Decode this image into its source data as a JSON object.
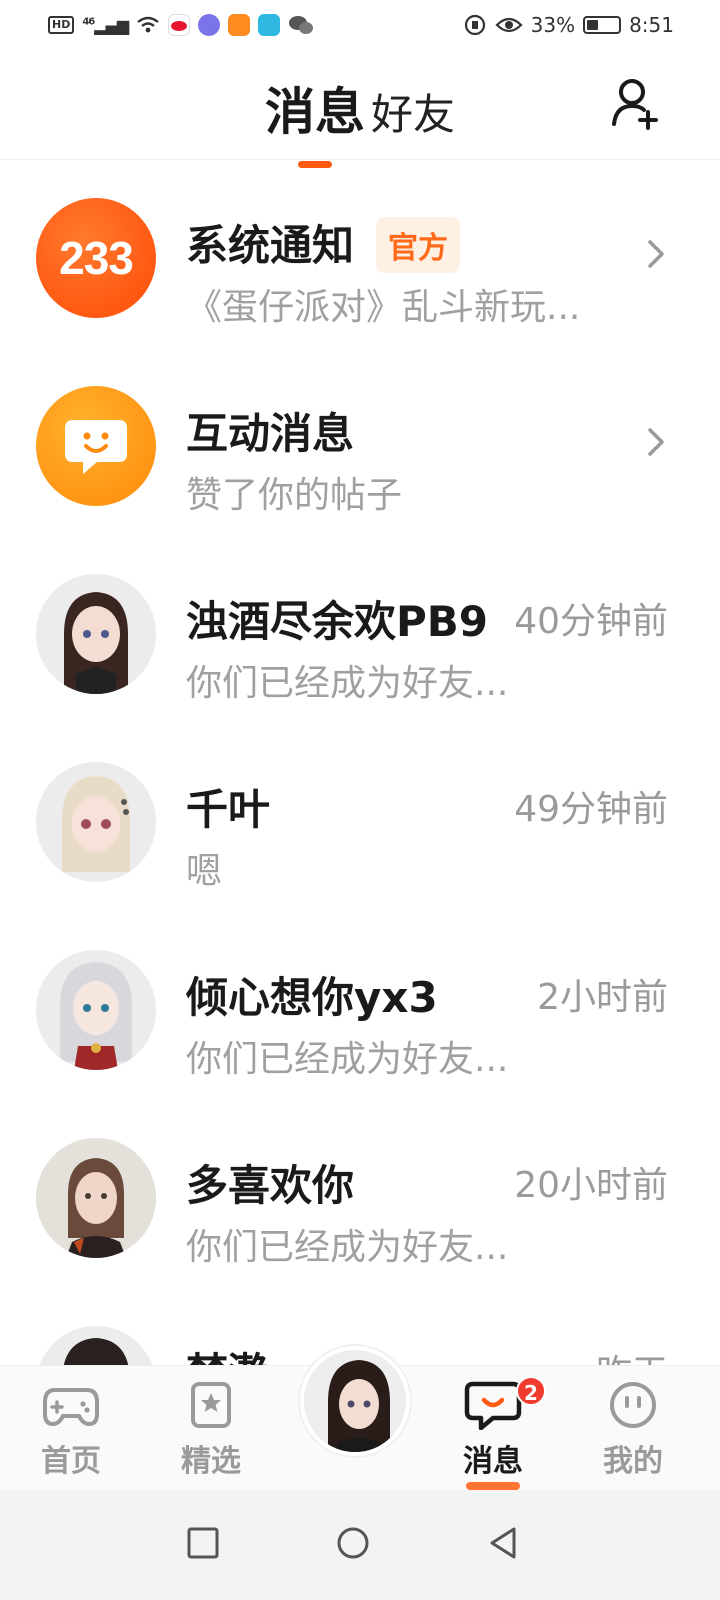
{
  "status_bar": {
    "hd": "HD",
    "network": "46",
    "battery": "33%",
    "time": "8:51"
  },
  "header": {
    "tab_active": "消息",
    "tab_inactive": "好友",
    "add_friend_icon": "add-user-icon"
  },
  "conversations": [
    {
      "name": "系统通知",
      "tag": "官方",
      "preview": "《蛋仔派对》乱斗新玩...",
      "time": "",
      "avatar_text": "233",
      "chevron": true
    },
    {
      "name": "互动消息",
      "tag": "",
      "preview": "赞了你的帖子",
      "time": "",
      "avatar_icon": "smile-chat-icon",
      "chevron": true
    },
    {
      "name": "浊酒尽余欢PB9",
      "preview": "你们已经成为好友...",
      "time": "40分钟前"
    },
    {
      "name": "千叶",
      "preview": "嗯",
      "time": "49分钟前"
    },
    {
      "name": "倾心想你yx3",
      "preview": "你们已经成为好友...",
      "time": "2小时前"
    },
    {
      "name": "多喜欢你",
      "preview": "你们已经成为好友...",
      "time": "20小时前"
    },
    {
      "name": "梦瀞",
      "preview": "",
      "time": "昨天"
    }
  ],
  "bottom_nav": {
    "items": [
      {
        "label": "首页",
        "icon": "gamepad-icon"
      },
      {
        "label": "精选",
        "icon": "star-bookmark-icon"
      },
      {
        "label": "消息",
        "icon": "message-icon",
        "badge": "2"
      },
      {
        "label": "我的",
        "icon": "face-icon"
      }
    ]
  },
  "colors": {
    "accent": "#ff5a0f",
    "official_tag_bg": "#fff0e4",
    "official_tag_text": "#ff6a1a",
    "badge": "#f03c2e"
  }
}
